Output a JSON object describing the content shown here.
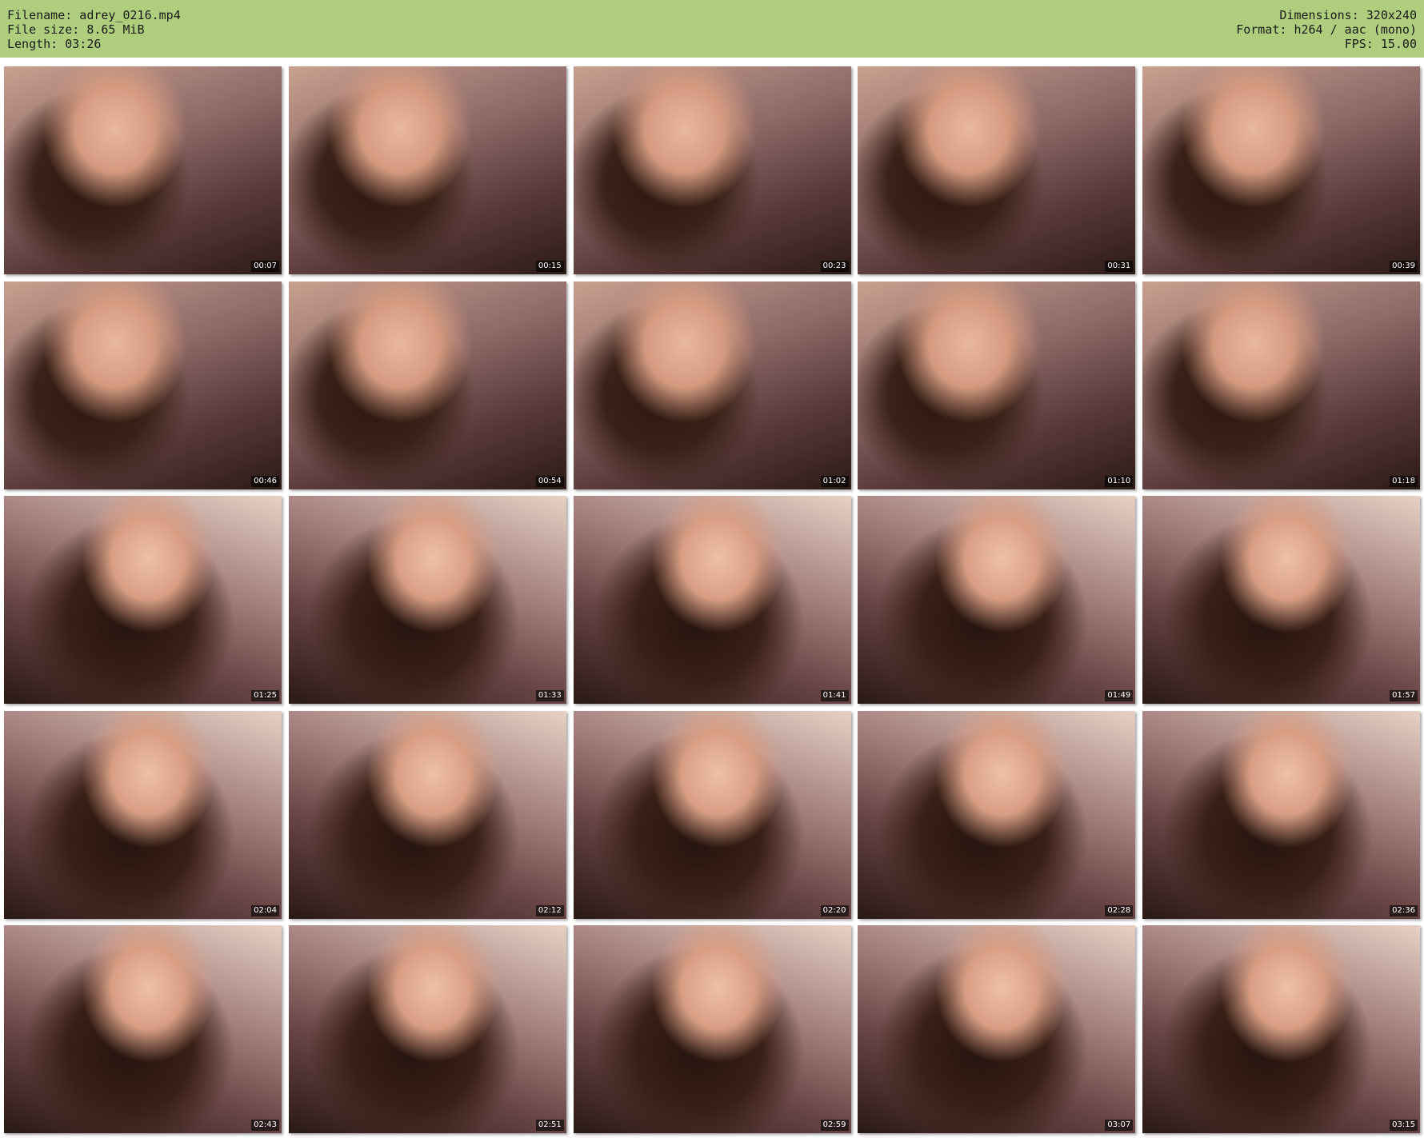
{
  "header": {
    "filename": "Filename: adrey_0216.mp4",
    "filesize": "File size: 8.65 MiB",
    "length": "Length: 03:26",
    "dimensions": "Dimensions: 320x240",
    "format": "Format: h264 / aac (mono)",
    "fps": "FPS: 15.00"
  },
  "colors": {
    "header_bg": "#aece7e",
    "page_bg": "#ffffff"
  },
  "thumbnails": [
    {
      "timestamp": "00:07"
    },
    {
      "timestamp": "00:15"
    },
    {
      "timestamp": "00:23"
    },
    {
      "timestamp": "00:31"
    },
    {
      "timestamp": "00:39"
    },
    {
      "timestamp": "00:46"
    },
    {
      "timestamp": "00:54"
    },
    {
      "timestamp": "01:02"
    },
    {
      "timestamp": "01:10"
    },
    {
      "timestamp": "01:18"
    },
    {
      "timestamp": "01:25"
    },
    {
      "timestamp": "01:33"
    },
    {
      "timestamp": "01:41"
    },
    {
      "timestamp": "01:49"
    },
    {
      "timestamp": "01:57"
    },
    {
      "timestamp": "02:04"
    },
    {
      "timestamp": "02:12"
    },
    {
      "timestamp": "02:20"
    },
    {
      "timestamp": "02:28"
    },
    {
      "timestamp": "02:36"
    },
    {
      "timestamp": "02:43"
    },
    {
      "timestamp": "02:51"
    },
    {
      "timestamp": "02:59"
    },
    {
      "timestamp": "03:07"
    },
    {
      "timestamp": "03:15"
    }
  ]
}
